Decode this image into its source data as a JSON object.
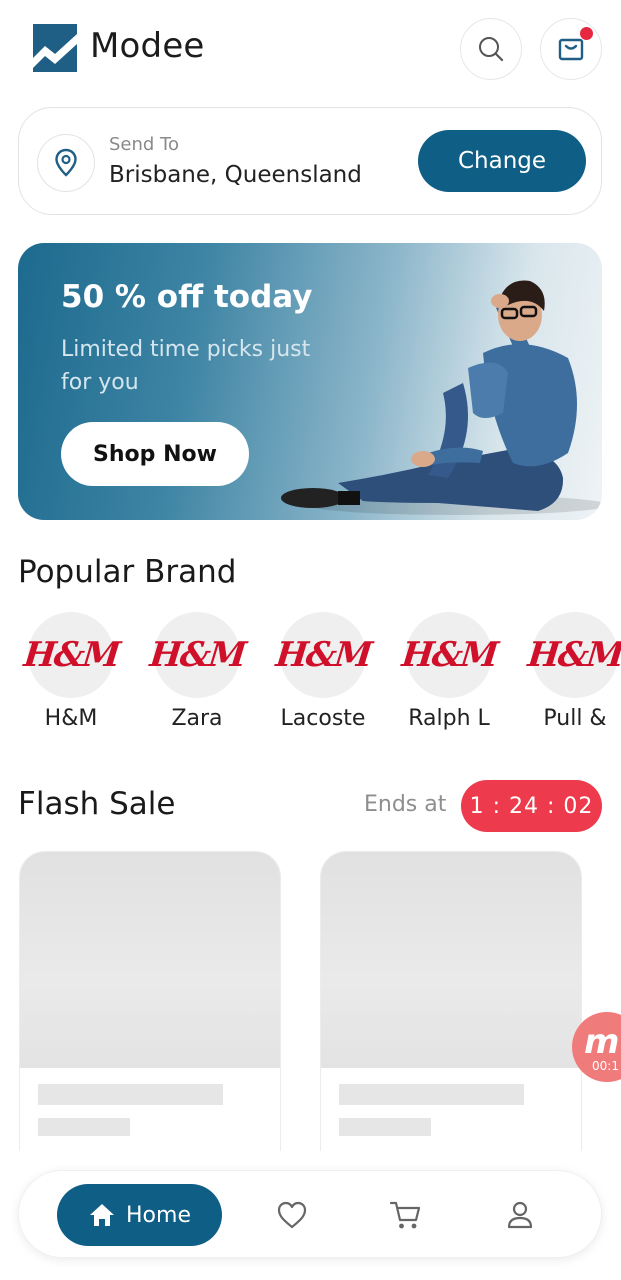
{
  "header": {
    "app_title": "Modee",
    "logo_icon": "modee-logo-icon",
    "search_icon": "search-icon",
    "bag_icon": "shopping-bag-icon"
  },
  "location": {
    "label": "Send To",
    "value": "Brisbane, Queensland",
    "change_label": "Change",
    "icon": "map-pin-icon"
  },
  "banner": {
    "title": "50 % off today",
    "subtitle": "Limited time picks just for you",
    "cta_label": "Shop Now"
  },
  "popular_brand": {
    "title": "Popular Brand",
    "items": [
      {
        "logo": "H&M",
        "name": "H&M"
      },
      {
        "logo": "H&M",
        "name": "Zara"
      },
      {
        "logo": "H&M",
        "name": "Lacoste"
      },
      {
        "logo": "H&M",
        "name": "Ralph L"
      },
      {
        "logo": "H&M",
        "name": "Pull &"
      }
    ]
  },
  "flash_sale": {
    "title": "Flash Sale",
    "ends_label": "Ends at",
    "timer": "1 : 24 : 02"
  },
  "recorder_badge": {
    "time": "00:1"
  },
  "bottom_nav": {
    "home_label": "Home",
    "items": [
      "home-icon",
      "heart-icon",
      "cart-icon",
      "profile-icon"
    ]
  },
  "colors": {
    "primary": "#0f5e86",
    "timer": "#ed3a4c",
    "brand_logo": "#d0102a"
  }
}
